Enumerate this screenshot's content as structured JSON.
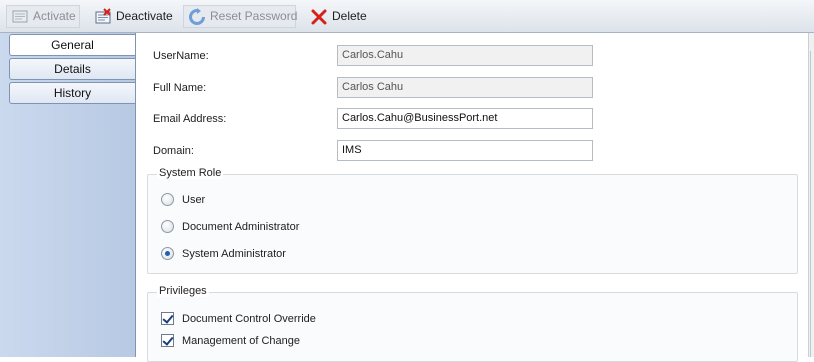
{
  "toolbar": {
    "activate_label": "Activate",
    "deactivate_label": "Deactivate",
    "reset_password_label": "Reset Password",
    "delete_label": "Delete"
  },
  "tabs": [
    {
      "label": "General",
      "active": true
    },
    {
      "label": "Details",
      "active": false
    },
    {
      "label": "History",
      "active": false
    }
  ],
  "form": {
    "username": {
      "label": "UserName:",
      "value": "Carlos.Cahu",
      "readonly": true
    },
    "fullname": {
      "label": "Full Name:",
      "value": "Carlos Cahu",
      "readonly": true
    },
    "email": {
      "label": "Email Address:",
      "value": "Carlos.Cahu@BusinessPort.net",
      "readonly": false
    },
    "domain": {
      "label": "Domain:",
      "value": "IMS",
      "readonly": false
    }
  },
  "system_role": {
    "title": "System Role",
    "options": [
      {
        "label": "User",
        "selected": false
      },
      {
        "label": "Document Administrator",
        "selected": false
      },
      {
        "label": "System Administrator",
        "selected": true
      }
    ]
  },
  "privileges": {
    "title": "Privileges",
    "options": [
      {
        "label": "Document Control Override",
        "checked": true
      },
      {
        "label": "Management of Change",
        "checked": true
      }
    ]
  },
  "colors": {
    "toolbar_bg": "#dde3ea",
    "tab_panel_bg": "#c3d3ea",
    "radio_selected": "#1f5fb5",
    "delete_icon": "#d6201a"
  },
  "icons": {
    "activate": "document-check-icon",
    "deactivate": "document-x-icon",
    "reset_password": "refresh-icon",
    "delete": "red-x-icon"
  }
}
